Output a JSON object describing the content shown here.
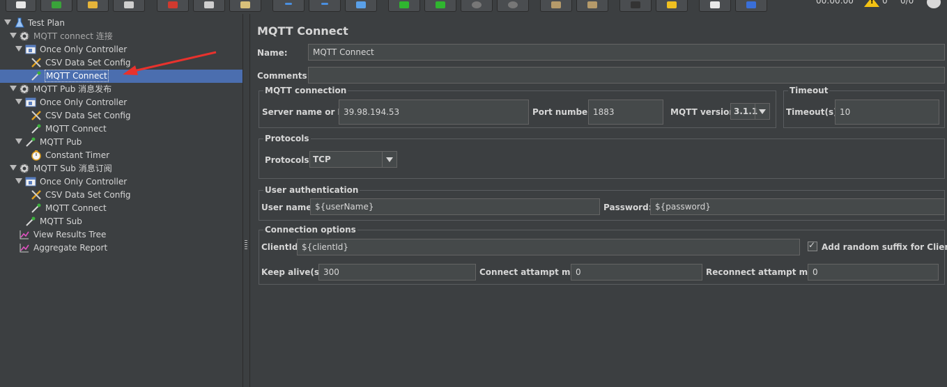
{
  "toolbar": {
    "timer": "00:00:00",
    "warnings": "0",
    "threads": "0/0"
  },
  "tree": [
    {
      "label": "Test Plan",
      "icon": "flask-icon",
      "dim": false
    },
    {
      "label": "MQTT connect 连接",
      "icon": "gear-icon",
      "dim": true
    },
    {
      "label": "Once Only Controller",
      "icon": "controller-icon",
      "dim": false
    },
    {
      "label": "CSV Data Set Config",
      "icon": "tools-icon",
      "dim": false
    },
    {
      "label": "MQTT Connect",
      "icon": "pipette-icon",
      "dim": false,
      "selected": true
    },
    {
      "label": "MQTT Pub 消息发布",
      "icon": "gear-icon",
      "dim": false
    },
    {
      "label": "Once Only Controller",
      "icon": "controller-icon",
      "dim": false
    },
    {
      "label": "CSV Data Set Config",
      "icon": "tools-icon",
      "dim": false
    },
    {
      "label": "MQTT Connect",
      "icon": "pipette-icon",
      "dim": false
    },
    {
      "label": "MQTT Pub",
      "icon": "pipette-icon",
      "dim": false
    },
    {
      "label": "Constant Timer",
      "icon": "stopwatch-icon",
      "dim": false
    },
    {
      "label": "MQTT Sub 消息订阅",
      "icon": "gear-icon",
      "dim": false
    },
    {
      "label": "Once Only Controller",
      "icon": "controller-icon",
      "dim": false
    },
    {
      "label": "CSV Data Set Config",
      "icon": "tools-icon",
      "dim": false
    },
    {
      "label": "MQTT Connect",
      "icon": "pipette-icon",
      "dim": false
    },
    {
      "label": "MQTT Sub",
      "icon": "pipette-icon",
      "dim": false
    },
    {
      "label": "View Results Tree",
      "icon": "graph-icon",
      "dim": false
    },
    {
      "label": "Aggregate Report",
      "icon": "graph-icon",
      "dim": false
    }
  ],
  "panel": {
    "title": "MQTT Connect",
    "name_label": "Name:",
    "name_value": "MQTT Connect",
    "comments_label": "Comments:",
    "comments_value": "",
    "mqtt_connection": {
      "title": "MQTT connection",
      "server_label": "Server name or IP:",
      "server_value": "39.98.194.53",
      "port_label": "Port number:",
      "port_value": "1883",
      "version_label": "MQTT version:",
      "version_value": "3.1.1"
    },
    "timeout": {
      "title": "Timeout",
      "label": "Timeout(s):",
      "value": "10"
    },
    "protocols": {
      "title": "Protocols",
      "label": "Protocols:",
      "value": "TCP"
    },
    "auth": {
      "title": "User authentication",
      "user_label": "User name:",
      "user_value": "${userName}",
      "password_label": "Password:",
      "password_value": "${password}"
    },
    "options": {
      "title": "Connection options",
      "clientid_label": "ClientId:",
      "clientid_value": "${clientId}",
      "random_suffix_label": "Add random suffix for ClientId",
      "random_suffix_checked": true,
      "keepalive_label": "Keep alive(s):",
      "keepalive_value": "300",
      "connect_max_label": "Connect attampt max:",
      "connect_max_value": "0",
      "reconnect_max_label": "Reconnect attampt max:",
      "reconnect_max_value": "0"
    }
  },
  "colors": {
    "background": "#3c3f41",
    "selection": "#4b6eaf",
    "field": "#45494a",
    "arrow": "#e8322d"
  }
}
